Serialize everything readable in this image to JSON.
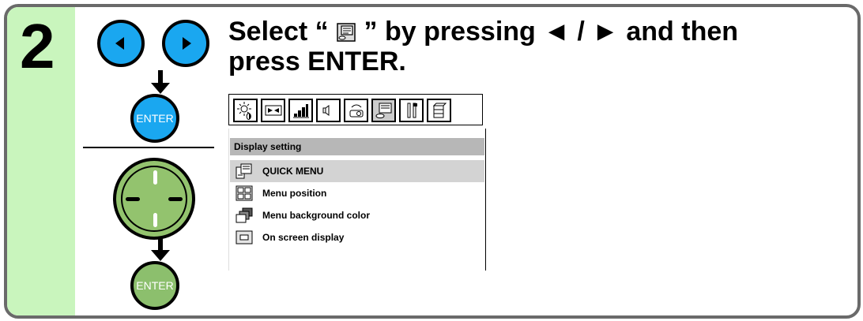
{
  "step": {
    "number": "2"
  },
  "buttons": {
    "enter_top": "ENTER",
    "enter_bottom": "ENTER"
  },
  "heading": {
    "part1": "Select “",
    "part2": "” by pressing",
    "part3": "◄ / ► and then",
    "line2": "press ENTER."
  },
  "menu": {
    "title": "Display setting",
    "items": [
      {
        "label": "QUICK MENU",
        "icon": "quick-menu-icon",
        "selected": true
      },
      {
        "label": "Menu position",
        "icon": "menu-position-icon",
        "selected": false
      },
      {
        "label": "Menu background color",
        "icon": "menu-background-icon",
        "selected": false
      },
      {
        "label": "On screen display",
        "icon": "on-screen-display-icon",
        "selected": false
      }
    ]
  },
  "colors": {
    "panel_bg": "#c9f5bd",
    "blue_button": "#1aa7f0",
    "green_button": "#8cbf6d",
    "border": "#6a6a6a"
  }
}
